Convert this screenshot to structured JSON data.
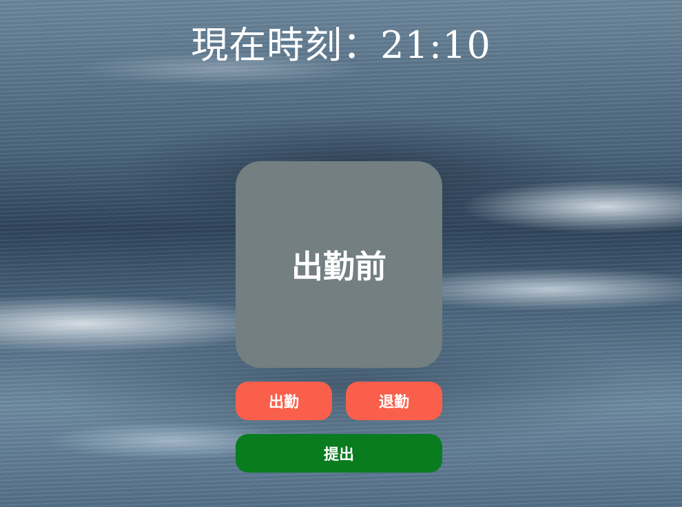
{
  "clock": {
    "label": "現在時刻：21:10"
  },
  "status": {
    "text": "出勤前"
  },
  "actions": {
    "clock_in_label": "出勤",
    "clock_out_label": "退勤",
    "submit_label": "提出"
  },
  "colors": {
    "status_card": "#737f80",
    "clock_in_out_button": "#fa5f4b",
    "submit_button": "#097c1f",
    "text": "#ffffff"
  }
}
